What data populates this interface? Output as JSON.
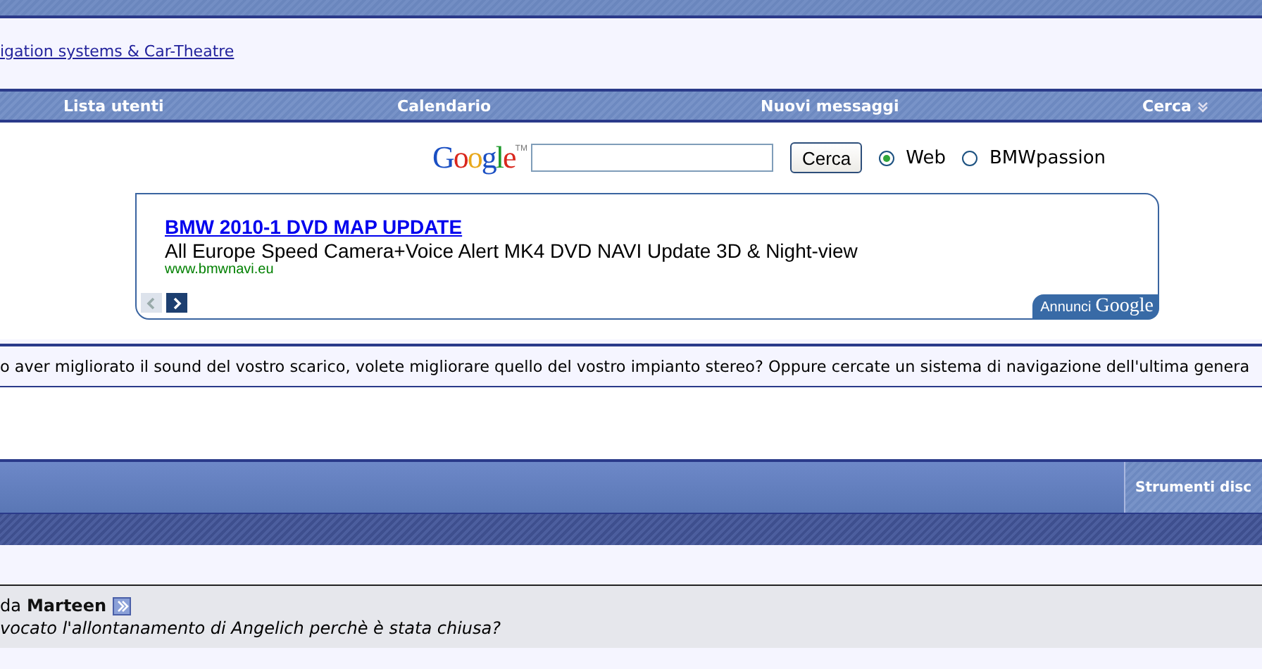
{
  "breadcrumb": {
    "link": "igation systems & Car-Theatre"
  },
  "nav": [
    {
      "label": "Lista utenti",
      "dropdown": false
    },
    {
      "label": "Calendario",
      "dropdown": false
    },
    {
      "label": "Nuovi messaggi",
      "dropdown": false
    },
    {
      "label": "Cerca",
      "dropdown": true
    }
  ],
  "google_search": {
    "logo": "Google",
    "tm": "TM",
    "button": "Cerca",
    "options": [
      {
        "label": "Web",
        "selected": true
      },
      {
        "label": "BMWpassion",
        "selected": false
      }
    ]
  },
  "ad": {
    "title": "BMW 2010-1 DVD MAP UPDATE",
    "text": "All Europe Speed Camera+Voice Alert MK4 DVD NAVI Update 3D & Night-view",
    "url": "www.bmwnavi.eu",
    "prev_disabled": true,
    "badge_label": "Annunci",
    "badge_brand": "Google"
  },
  "forum_description": "o aver migliorato il sound del vostro scarico, volete migliorare quello del vostro impianto stereo? Oppure cercate un sistema di navigazione dell'ultima genera",
  "thread_tools": {
    "label": "Strumenti disc"
  },
  "last_post": {
    "prefix": "da",
    "author": "Marteen",
    "excerpt": "vocato l'allontanamento di Angelich perchè è stata chiusa?"
  }
}
